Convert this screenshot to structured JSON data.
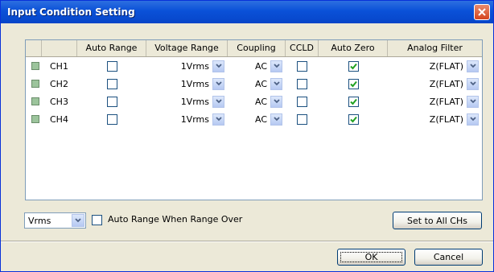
{
  "window": {
    "title": "Input Condition Setting"
  },
  "grid": {
    "headers": [
      "",
      "",
      "Auto Range",
      "Voltage Range",
      "Coupling",
      "CCLD",
      "Auto Zero",
      "Analog Filter"
    ],
    "rows": [
      {
        "channel": "CH1",
        "auto_range": false,
        "voltage_range": "1Vrms",
        "coupling": "AC",
        "ccld": false,
        "auto_zero": true,
        "analog_filter": "Z(FLAT)"
      },
      {
        "channel": "CH2",
        "auto_range": false,
        "voltage_range": "1Vrms",
        "coupling": "AC",
        "ccld": false,
        "auto_zero": true,
        "analog_filter": "Z(FLAT)"
      },
      {
        "channel": "CH3",
        "auto_range": false,
        "voltage_range": "1Vrms",
        "coupling": "AC",
        "ccld": false,
        "auto_zero": true,
        "analog_filter": "Z(FLAT)"
      },
      {
        "channel": "CH4",
        "auto_range": false,
        "voltage_range": "1Vrms",
        "coupling": "AC",
        "ccld": false,
        "auto_zero": true,
        "analog_filter": "Z(FLAT)"
      }
    ]
  },
  "bottom": {
    "unit_value": "Vrms",
    "auto_range_over_label": "Auto Range When Range Over",
    "auto_range_over_checked": false,
    "set_all_label": "Set to All CHs"
  },
  "buttons": {
    "ok": "OK",
    "cancel": "Cancel"
  },
  "colors": {
    "title_bar": "#0a51d8",
    "dialog_bg": "#ece9d8",
    "grid_border": "#7f9db9",
    "check_mark": "#21a121"
  },
  "icons": {
    "close": "close-icon",
    "dropdown": "chevron-down-icon",
    "check": "check-icon"
  }
}
